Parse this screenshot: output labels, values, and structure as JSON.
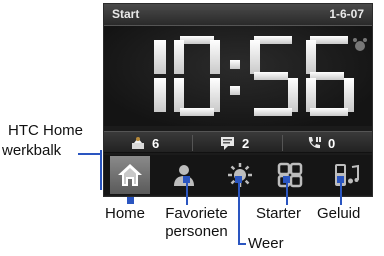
{
  "screen": {
    "title": "Start",
    "date": "1-6-07",
    "clock": "10:56"
  },
  "status": {
    "missed_calls_count": "6",
    "messages_count": "2",
    "voicemail_count": "0"
  },
  "toolbar": {
    "items": [
      "home-icon",
      "people-icon",
      "weather-icon",
      "launcher-icon",
      "sound-icon"
    ],
    "active_index": 0
  },
  "labels": {
    "toolbar_label": "HTC Home werkbalk",
    "home": "Home",
    "favorites": "Favoriete personen",
    "weather": "Weer",
    "starter": "Starter",
    "sound": "Geluid"
  },
  "colors": {
    "accent": "#2a55c0",
    "screen_bg": "#1b1b1b",
    "active_tab": "#7a7a7a"
  }
}
